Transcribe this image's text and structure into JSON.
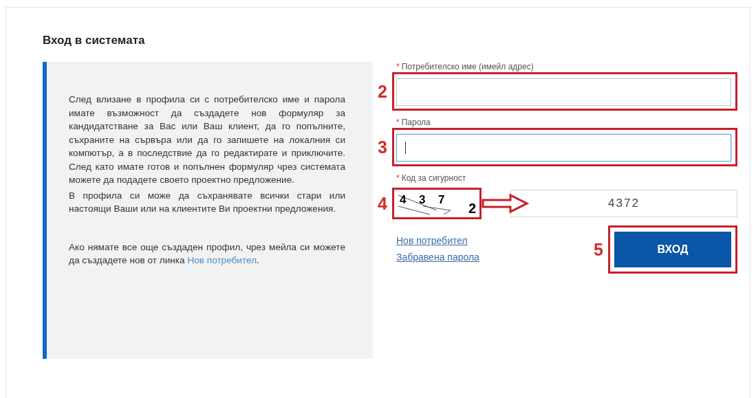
{
  "title": "Вход в системата",
  "info": {
    "paragraphs": [
      "След влизане в профила си с потребителско име и парола имате възможност да създадете нов формуляр за кандидатстване за Вас или Ваш клиент, да го попълните, съхраните на сървъра или да го запишете на локалния си компютър, а в последствие да го редактирате и приключите. След като имате готов и попълнен формуляр чрез системата можете да подадете своето проектно предложение.",
      "В профила си може да съхранявате всички стари или настоящи Ваши или на клиентите Ви проектни предложения."
    ],
    "closing": {
      "text": "Ако нямате все още създаден профил, чрез мейла си можете да създадете нов от линка",
      "link": "Нов потребител",
      "tail": "."
    }
  },
  "form": {
    "fields": [
      {
        "mark": "*",
        "label": "Потребителско име (имейл адрес)",
        "focused": false,
        "marker": "2"
      },
      {
        "mark": "*",
        "label": "Парола",
        "focused": true,
        "marker": "3"
      }
    ],
    "captcha": {
      "mark": "*",
      "label": "Код за сигурност",
      "chars": [
        "4",
        "3",
        "7",
        "2"
      ],
      "value": "4372",
      "marker": "4"
    },
    "links": [
      "Нов потребител",
      "Забравена парола"
    ],
    "submit": {
      "label": "ВХОД",
      "marker": "5"
    }
  }
}
